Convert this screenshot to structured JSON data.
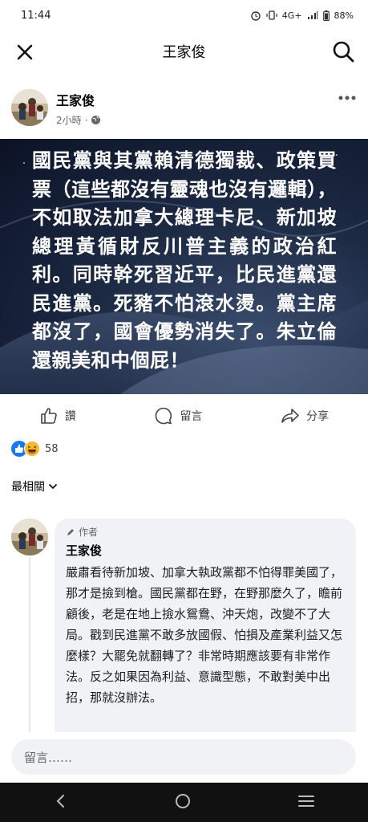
{
  "status_bar": {
    "time": "11:44",
    "network": "4G+",
    "battery": "88%"
  },
  "header": {
    "title": "王家俊"
  },
  "post": {
    "author": "王家俊",
    "time": "2小時",
    "separator": "·",
    "text": "國民黨與其黨賴清德獨裁、政策買票（這些都沒有靈魂也沒有邏輯），不如取法加拿大總理卡尼、新加坡總理黃循財反川普主義的政治紅利。同時幹死習近平，比民進黨還民進黨。死豬不怕滾水燙。黨主席都沒了，國會優勢消失了。朱立倫還親美和中個屁！"
  },
  "actions": {
    "like": "讚",
    "comment": "留言",
    "share": "分享"
  },
  "reactions": {
    "count": "58"
  },
  "sort": {
    "label": "最相關"
  },
  "comment": {
    "badge": "作者",
    "author": "王家俊",
    "text": "嚴肅看待新加坡、加拿大執政黨都不怕得罪美國了，那才是撿到槍。國民黨都在野，在野那麼久了，瞻前顧後，老是在地上撿水鴛鴦、沖天炮，改變不了大局。戳到民進黨不敢多放國假、怕損及產業利益又怎麼樣？大罷免就翻轉了？非常時期應該要有非常作法。反之如果因為利益、意識型態，不敢對美中出招，那就沒辦法。"
  },
  "composer": {
    "placeholder": "留言……"
  },
  "colors": {
    "like_blue": "#1877f2",
    "haha_yellow": "#f7b928",
    "composer_bg": "#f0f2f5",
    "nav_bg": "#111111"
  },
  "icons": [
    "close-icon",
    "search-icon",
    "more-icon",
    "globe-icon",
    "thumbs-up-icon",
    "comment-icon",
    "share-icon",
    "like-reaction-icon",
    "haha-reaction-icon",
    "chevron-down-icon",
    "pencil-icon",
    "back-icon",
    "home-icon",
    "recents-icon"
  ]
}
